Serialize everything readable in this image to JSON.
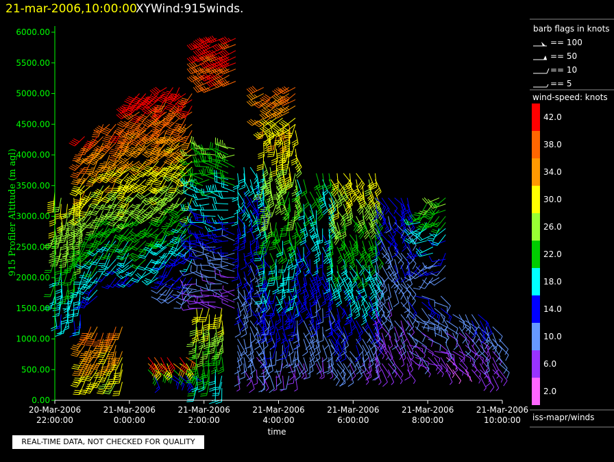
{
  "title": {
    "date": "21-mar-2006,10:00:00",
    "product": "XYWind:915winds."
  },
  "chart_data": {
    "type": "wind-barb",
    "ylabel": "915 Profiler Altitude (m agl)",
    "xlabel": "time",
    "ylim": [
      0,
      6200
    ],
    "y_ticks": [
      "0.00",
      "500.00",
      "1000.00",
      "1500.00",
      "2000.00",
      "2500.00",
      "3000.00",
      "3500.00",
      "4000.00",
      "4500.00",
      "5000.00",
      "5500.00",
      "6000.00"
    ],
    "x_range_hours": [
      22,
      34
    ],
    "x_ticks": [
      {
        "date": "20-Mar-2006",
        "time": "22:00:00",
        "hour": 22
      },
      {
        "date": "21-Mar-2006",
        "time": "0:00:00",
        "hour": 24
      },
      {
        "date": "21-Mar-2006",
        "time": "2:00:00",
        "hour": 26
      },
      {
        "date": "21-Mar-2006",
        "time": "4:00:00",
        "hour": 28
      },
      {
        "date": "21-Mar-2006",
        "time": "6:00:00",
        "hour": 30
      },
      {
        "date": "21-Mar-2006",
        "time": "8:00:00",
        "hour": 32
      },
      {
        "date": "21-Mar-2006",
        "time": "10:00:00",
        "hour": 34
      }
    ],
    "segments": [
      {
        "hours": [
          22.0,
          22.8
        ],
        "alt": [
          1300,
          3400
        ],
        "spd": [
          16,
          30
        ],
        "dir": [
          170,
          200
        ]
      },
      {
        "hours": [
          22.8,
          23.2
        ],
        "alt": [
          1700,
          4300
        ],
        "spd": [
          14,
          40
        ],
        "dir": [
          200,
          230
        ]
      },
      {
        "hours": [
          22.8,
          23.2
        ],
        "alt": [
          300,
          1200
        ],
        "spd": [
          30,
          36
        ],
        "dir": [
          200,
          215
        ]
      },
      {
        "hours": [
          23.3,
          23.9
        ],
        "alt": [
          300,
          1200
        ],
        "spd": [
          28,
          36
        ],
        "dir": [
          190,
          210
        ]
      },
      {
        "hours": [
          23.3,
          24.1
        ],
        "alt": [
          2000,
          4500
        ],
        "spd": [
          14,
          40
        ],
        "dir": [
          200,
          230
        ]
      },
      {
        "hours": [
          24.1,
          25.0
        ],
        "alt": [
          2000,
          5000
        ],
        "spd": [
          16,
          42
        ],
        "dir": [
          210,
          240
        ]
      },
      {
        "hours": [
          25.0,
          25.8
        ],
        "alt": [
          1700,
          5100
        ],
        "spd": [
          10,
          42
        ],
        "dir": [
          200,
          240
        ]
      },
      {
        "hours": [
          24.5,
          25.8
        ],
        "alt": [
          400,
          700
        ],
        "spd": [
          14,
          40
        ],
        "dir": [
          120,
          160
        ]
      },
      {
        "hours": [
          25.8,
          26.6
        ],
        "alt": [
          200,
          1500
        ],
        "spd": [
          18,
          30
        ],
        "dir": [
          170,
          200
        ]
      },
      {
        "hours": [
          25.8,
          26.9
        ],
        "alt": [
          1500,
          4100
        ],
        "spd": [
          6,
          24
        ],
        "dir": [
          250,
          300
        ]
      },
      {
        "hours": [
          26.9,
          27.6
        ],
        "alt": [
          400,
          3800
        ],
        "spd": [
          8,
          18
        ],
        "dir": [
          140,
          180
        ]
      },
      {
        "hours": [
          27.6,
          28.5
        ],
        "alt": [
          400,
          4500
        ],
        "spd": [
          8,
          32
        ],
        "dir": [
          150,
          200
        ]
      },
      {
        "hours": [
          28.5,
          29.4
        ],
        "alt": [
          600,
          3700
        ],
        "spd": [
          8,
          22
        ],
        "dir": [
          150,
          180
        ]
      },
      {
        "hours": [
          29.4,
          30.6
        ],
        "alt": [
          500,
          3700
        ],
        "spd": [
          8,
          30
        ],
        "dir": [
          140,
          175
        ]
      },
      {
        "hours": [
          30.6,
          31.5
        ],
        "alt": [
          500,
          3300
        ],
        "spd": [
          6,
          14
        ],
        "dir": [
          130,
          170
        ]
      },
      {
        "hours": [
          31.5,
          32.5
        ],
        "alt": [
          600,
          1700
        ],
        "spd": [
          6,
          12
        ],
        "dir": [
          100,
          150
        ]
      },
      {
        "hours": [
          31.8,
          32.5
        ],
        "alt": [
          2000,
          3300
        ],
        "spd": [
          10,
          24
        ],
        "dir": [
          200,
          260
        ]
      },
      {
        "hours": [
          32.5,
          33.4
        ],
        "alt": [
          500,
          1400
        ],
        "spd": [
          4,
          12
        ],
        "dir": [
          120,
          160
        ]
      },
      {
        "hours": [
          33.4,
          34.0
        ],
        "alt": [
          400,
          1300
        ],
        "spd": [
          6,
          12
        ],
        "dir": [
          130,
          170
        ]
      },
      {
        "hours": [
          26.0,
          27.0
        ],
        "alt": [
          5100,
          5900
        ],
        "spd": [
          38,
          42
        ],
        "dir": [
          240,
          250
        ]
      },
      {
        "hours": [
          27.6,
          28.6
        ],
        "alt": [
          4400,
          5100
        ],
        "spd": [
          30,
          38
        ],
        "dir": [
          230,
          245
        ]
      }
    ]
  },
  "legend": {
    "barb_title": "barb flags in knots",
    "barb_items": [
      "== 100",
      "== 50",
      "== 10",
      "== 5"
    ],
    "speed_title": "wind-speed: knots",
    "speed_bins": [
      {
        "label": "42.0",
        "color": "#ff0000"
      },
      {
        "label": "38.0",
        "color": "#ff6600"
      },
      {
        "label": "34.0",
        "color": "#ff9900"
      },
      {
        "label": "30.0",
        "color": "#ffff00"
      },
      {
        "label": "26.0",
        "color": "#99ff33"
      },
      {
        "label": "22.0",
        "color": "#00cc00"
      },
      {
        "label": "18.0",
        "color": "#00ffff"
      },
      {
        "label": "14.0",
        "color": "#0000ff"
      },
      {
        "label": "10.0",
        "color": "#6699ff"
      },
      {
        "label": "6.0",
        "color": "#9933ff"
      },
      {
        "label": "2.0",
        "color": "#ff66ff"
      }
    ],
    "source": "iss-mapr/winds"
  },
  "note": "REAL-TIME DATA, NOT CHECKED FOR QUALITY",
  "colors": {
    "axis": "#00ff00",
    "title_date": "#ffff00",
    "background": "#000000"
  }
}
